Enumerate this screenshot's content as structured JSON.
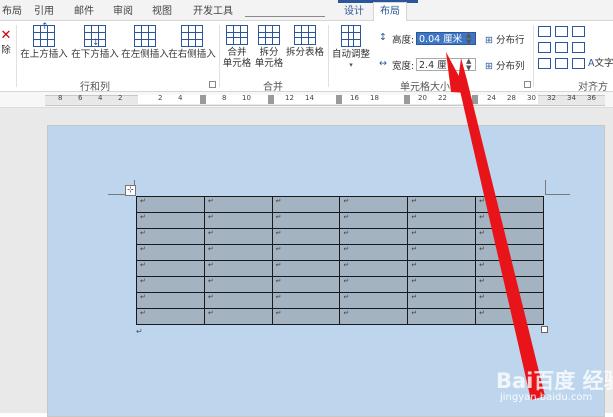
{
  "tabs": [
    {
      "label": "布局",
      "context": false
    },
    {
      "label": "引用",
      "context": false
    },
    {
      "label": "邮件",
      "context": false
    },
    {
      "label": "审阅",
      "context": false
    },
    {
      "label": "视图",
      "context": false
    },
    {
      "label": "开发工具",
      "context": false
    },
    {
      "label": "设计",
      "context": true
    },
    {
      "label": "布局",
      "context": true,
      "active": true
    }
  ],
  "ribbon": {
    "delete_fragment": "除",
    "rows_cols_group": "行和列",
    "insert_above": "在上方插入",
    "insert_below": "在下方插入",
    "insert_left": "在左侧插入",
    "insert_right": "在右侧插入",
    "merge_group": "合并",
    "merge_cells_1": "合并",
    "merge_cells_2": "单元格",
    "split_cells_1": "拆分",
    "split_cells_2": "单元格",
    "split_table": "拆分表格",
    "cell_size_group": "单元格大小",
    "autofit": "自动调整",
    "height_label": "高度:",
    "height_value": "0.04 厘米",
    "width_label": "宽度:",
    "width_value": "2.4 厘",
    "distribute_rows": "分布行",
    "distribute_cols": "分布列",
    "align_group": "对齐方",
    "text_fragment": "文字"
  },
  "ruler": {
    "numbers": [
      "8",
      "6",
      "4",
      "2",
      "2",
      "4",
      "8",
      "10",
      "12",
      "14",
      "16",
      "18",
      "20",
      "22",
      "24",
      "28",
      "30",
      "32",
      "34",
      "36"
    ]
  },
  "table": {
    "rows": 8,
    "cols": 6,
    "cell_mark": "↵"
  },
  "doc": {
    "move_handle": "⊹",
    "para_mark": "↵"
  },
  "watermark": {
    "logo": "Bai百度 经验",
    "url": "jingyan.baidu.com"
  },
  "colors": {
    "accent": "#2b579a",
    "arrow": "#e8141a",
    "page": "#bdd6ee",
    "cell": "#a3b3c2"
  }
}
